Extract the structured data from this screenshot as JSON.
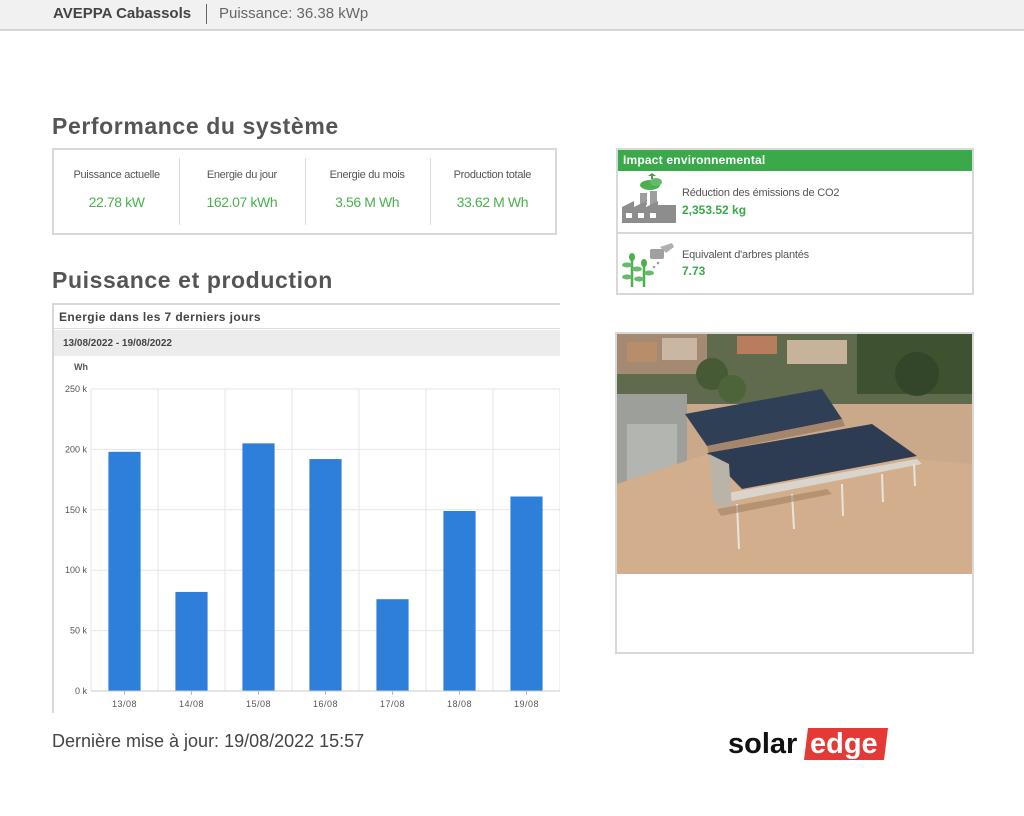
{
  "header": {
    "site_name": "AVEPPA Cabassols",
    "power_info": "Puissance: 36.38 kWp"
  },
  "performance": {
    "title": "Performance du système",
    "kpis": [
      {
        "label": "Puissance actuelle",
        "value": "22.78 kW"
      },
      {
        "label": "Energie du jour",
        "value": "162.07 kWh"
      },
      {
        "label": "Energie du mois",
        "value": "3.56 M Wh"
      },
      {
        "label": "Production totale",
        "value": "33.62 M Wh"
      }
    ]
  },
  "production": {
    "title": "Puissance et production",
    "chart_title": "Energie dans les 7 derniers jours",
    "date_range": "13/08/2022 - 19/08/2022"
  },
  "chart_data": {
    "type": "bar",
    "ylabel": "Wh",
    "categories": [
      "13/08",
      "14/08",
      "15/08",
      "16/08",
      "17/08",
      "18/08",
      "19/08"
    ],
    "values": [
      198000,
      82000,
      205000,
      192000,
      76000,
      149000,
      161000
    ],
    "ylim": [
      0,
      250000
    ],
    "yticks": [
      0,
      50000,
      100000,
      150000,
      200000,
      250000
    ],
    "ytick_labels": [
      "0 k",
      "50 k",
      "100 k",
      "150 k",
      "200 k",
      "250 k"
    ],
    "grid": true,
    "bar_color": "#2e7fd9"
  },
  "environment": {
    "title": "Impact environnemental",
    "items": [
      {
        "label": "Réduction des émissions de CO2",
        "value": "2,353.52 kg",
        "icon": "factory-icon"
      },
      {
        "label": "Equivalent d'arbres plantés",
        "value": "7.73",
        "icon": "watering-can-plants-icon"
      }
    ],
    "accent_color": "#3aa94a"
  },
  "photo": {
    "icon": "site-photo"
  },
  "footer": {
    "last_update": "Dernière mise à jour: 19/08/2022 15:57",
    "logo_left": "solar",
    "logo_right": "edge"
  }
}
